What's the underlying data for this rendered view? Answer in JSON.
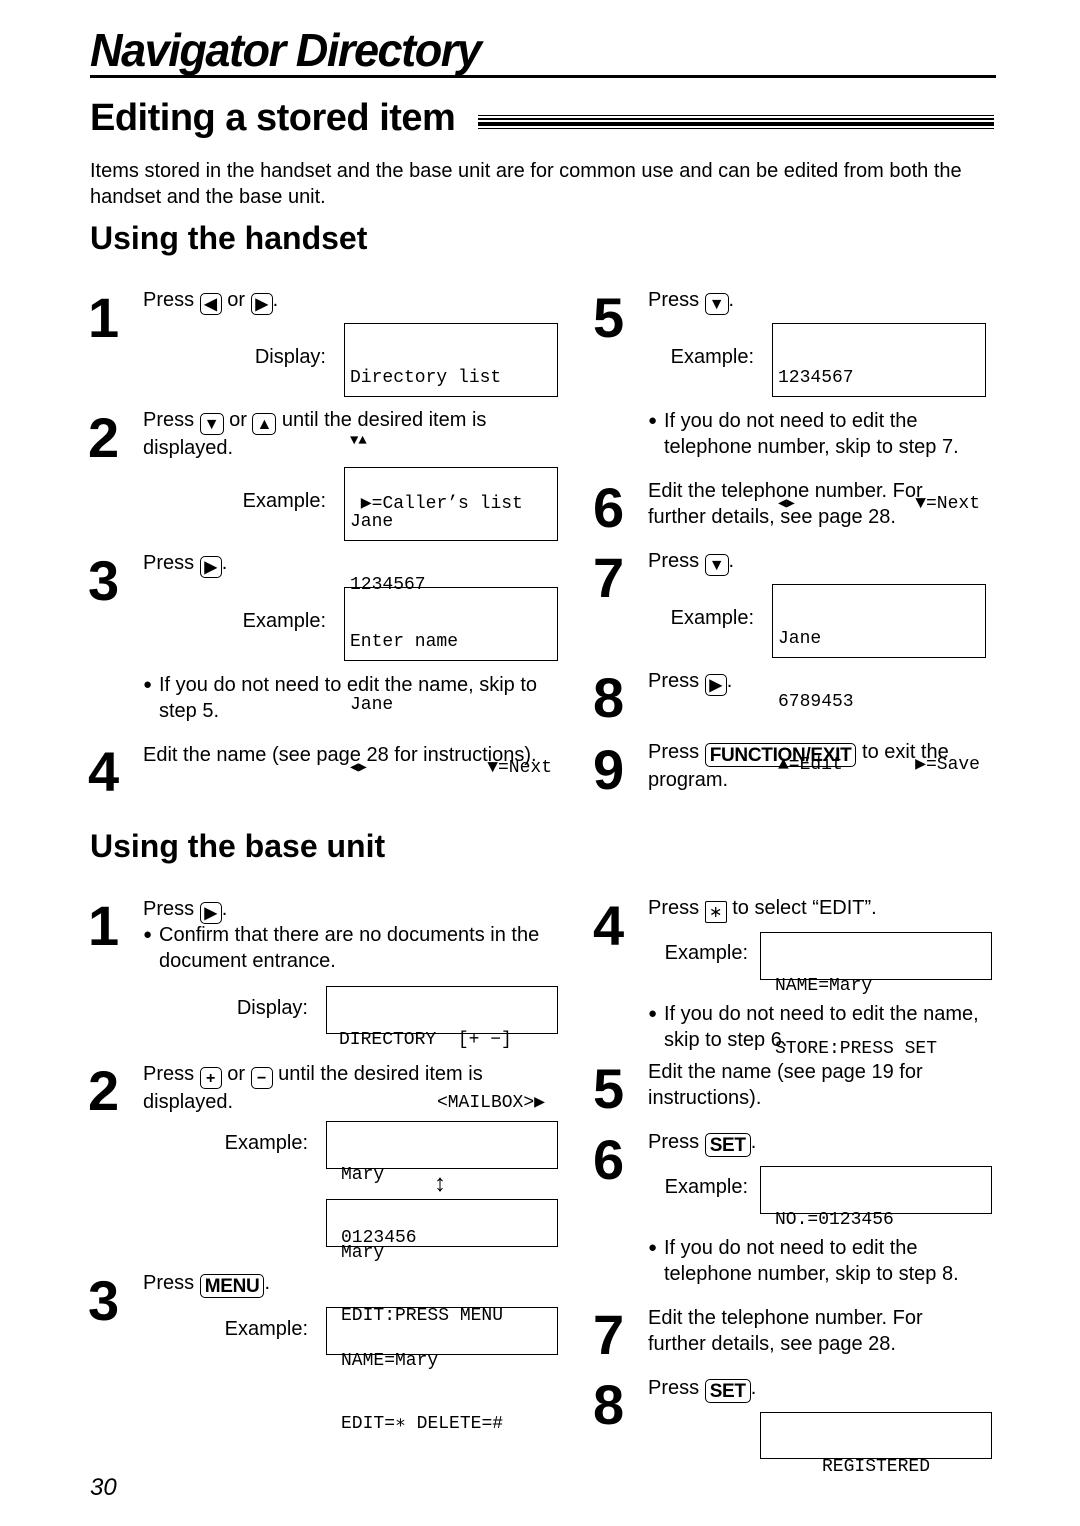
{
  "header": {
    "page_title": "Navigator Directory",
    "section_title": "Editing a stored item",
    "intro": "Items stored in the handset and the base unit are for common use and can be edited from both the handset and the base unit."
  },
  "handset": {
    "title": "Using the handset",
    "steps": [
      {
        "num": "1",
        "text_a": "Press",
        "key1": "◀",
        "or": "or",
        "key2": "▶",
        "end": ".",
        "display_label": "Display:",
        "lcd": [
          "Directory list",
          "▼▲",
          " ▶=Caller’s list"
        ]
      },
      {
        "num": "2",
        "text_a": "Press",
        "key1": "▼",
        "or": "or",
        "key2": "▲",
        "text_b": "until the desired item is",
        "text_c": "displayed.",
        "example_label": "Example:",
        "lcd": [
          "Jane",
          "1234567"
        ]
      },
      {
        "num": "3",
        "text_a": "Press",
        "key1": "▶",
        "end": ".",
        "example_label": "Example:",
        "lcd": [
          "Enter name",
          "Jane"
        ],
        "lcd_left": "◀▶",
        "lcd_right": "▼=Next",
        "bullet": "If you do not need to edit the name, skip to step 5."
      },
      {
        "num": "4",
        "text": "Edit the name (see page 28 for instructions)."
      },
      {
        "num": "5",
        "text_a": "Press",
        "key1": "▼",
        "end": ".",
        "example_label": "Example:",
        "lcd": [
          "1234567"
        ],
        "lcd_left": "◀▶",
        "lcd_right": "▼=Next",
        "bullet": "If you do not need to edit the telephone number, skip to step 7."
      },
      {
        "num": "6",
        "text": "Edit the telephone number. For further details, see page 28."
      },
      {
        "num": "7",
        "text_a": "Press",
        "key1": "▼",
        "end": ".",
        "example_label": "Example:",
        "lcd": [
          "Jane",
          "6789453"
        ],
        "lcd_left": "▲=Edit",
        "lcd_right": "▶=Save"
      },
      {
        "num": "8",
        "text_a": "Press",
        "key1": "▶",
        "end": "."
      },
      {
        "num": "9",
        "text_a": "Press",
        "key1": "FUNCTION/EXIT",
        "text_b": "to exit the",
        "text_c": "program."
      }
    ]
  },
  "base": {
    "title": "Using the base unit",
    "steps": [
      {
        "num": "1",
        "text_a": "Press",
        "key1": "▶",
        "end": ".",
        "bullet": "Confirm that there are no documents in the document entrance.",
        "display_label": "Display:",
        "lcd": [
          "DIRECTORY  [+ −]",
          "<MAILBOX>▶"
        ]
      },
      {
        "num": "2",
        "text_a": "Press",
        "key1": "+",
        "or": "or",
        "key2": "−",
        "text_b": "until the desired item is",
        "text_c": "displayed.",
        "example_label": "Example:",
        "lcd": [
          "Mary",
          "0123456"
        ],
        "lcd2": [
          "Mary",
          "EDIT:PRESS MENU"
        ],
        "toggle": "↕"
      },
      {
        "num": "3",
        "text_a": "Press",
        "key1": "MENU",
        "end": ".",
        "example_label": "Example:",
        "lcd": [
          "NAME=Mary",
          "EDIT=∗ DELETE=#"
        ]
      },
      {
        "num": "4",
        "text_a": "Press",
        "key1": "∗",
        "text_b": "to select “EDIT”.",
        "example_label": "Example:",
        "lcd": [
          "NAME=Mary",
          "STORE:PRESS SET"
        ],
        "bullet": "If you do not need to edit the name, skip to step 6."
      },
      {
        "num": "5",
        "text": "Edit the name (see page 19 for instructions)."
      },
      {
        "num": "6",
        "text_a": "Press",
        "key1": "SET",
        "end": ".",
        "example_label": "Example:",
        "lcd": [
          "NO.=0123456"
        ],
        "bullet": "If you do not need to edit the telephone number, skip to step 8."
      },
      {
        "num": "7",
        "text": "Edit the telephone number. For further details, see page 28."
      },
      {
        "num": "8",
        "text_a": "Press",
        "key1": "SET",
        "end": ".",
        "lcd": [
          "REGISTERED"
        ]
      }
    ]
  },
  "footer": {
    "page_number": "30"
  },
  "bullet_glyph": "●"
}
